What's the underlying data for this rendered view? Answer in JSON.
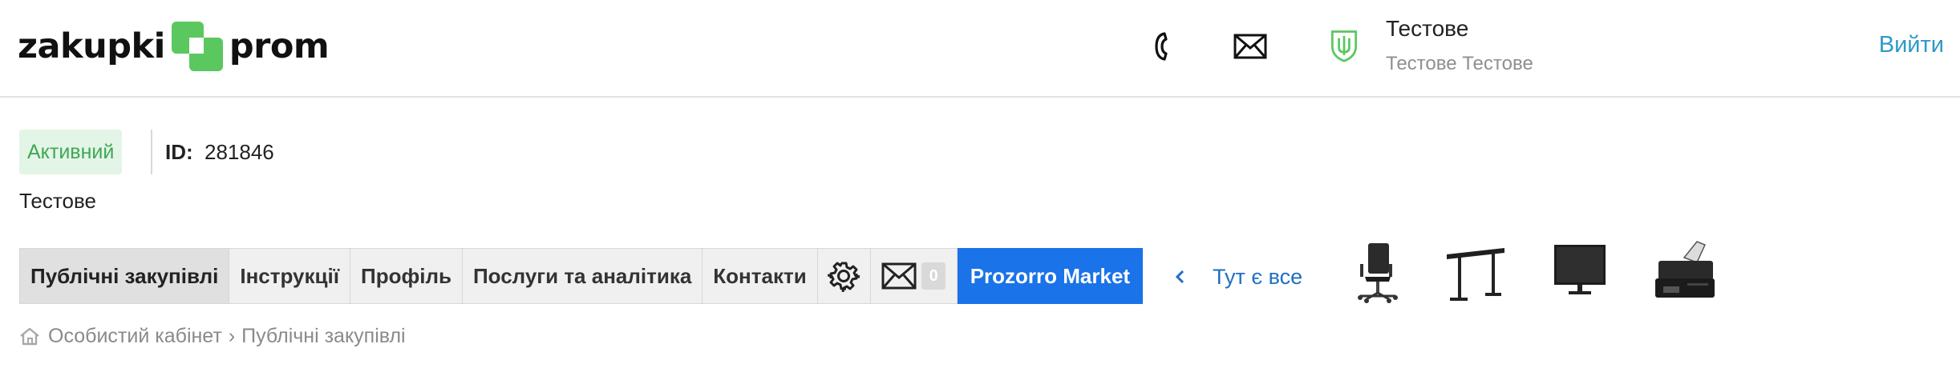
{
  "header": {
    "logo": {
      "left_word": "zakupki",
      "right_word": "prom"
    },
    "icons": [
      "phone-icon",
      "mail-icon",
      "shield-icon"
    ],
    "user_name": "Тестове",
    "user_org": "Тестове Тестове",
    "logout_label": "Вийти"
  },
  "status": {
    "badge": "Активний",
    "id_label": "ID:",
    "id_value": "281846",
    "entity_name": "Тестове"
  },
  "nav": {
    "items": [
      {
        "label": "Публічні закупівлі",
        "active": true
      },
      {
        "label": "Інструкції"
      },
      {
        "label": "Профіль"
      },
      {
        "label": "Послуги та аналітика"
      },
      {
        "label": "Контакти"
      }
    ],
    "settings_icon": "gear-icon",
    "messages_icon": "envelope-icon",
    "messages_count": "0",
    "market_label": "Prozorro Market"
  },
  "promo": {
    "label": "Тут є все",
    "products": [
      "office-chair",
      "standing-desk",
      "monitor",
      "printer"
    ]
  },
  "breadcrumb": {
    "home": "Особистий кабінет",
    "separator": "›",
    "current": "Публічні закупівлі"
  },
  "colors": {
    "brand_green": "#5ac85f",
    "accent_blue": "#1a73e8",
    "link_blue": "#2e9ac7",
    "status_green_bg": "#e3f5e6",
    "status_green_text": "#3fa755"
  }
}
